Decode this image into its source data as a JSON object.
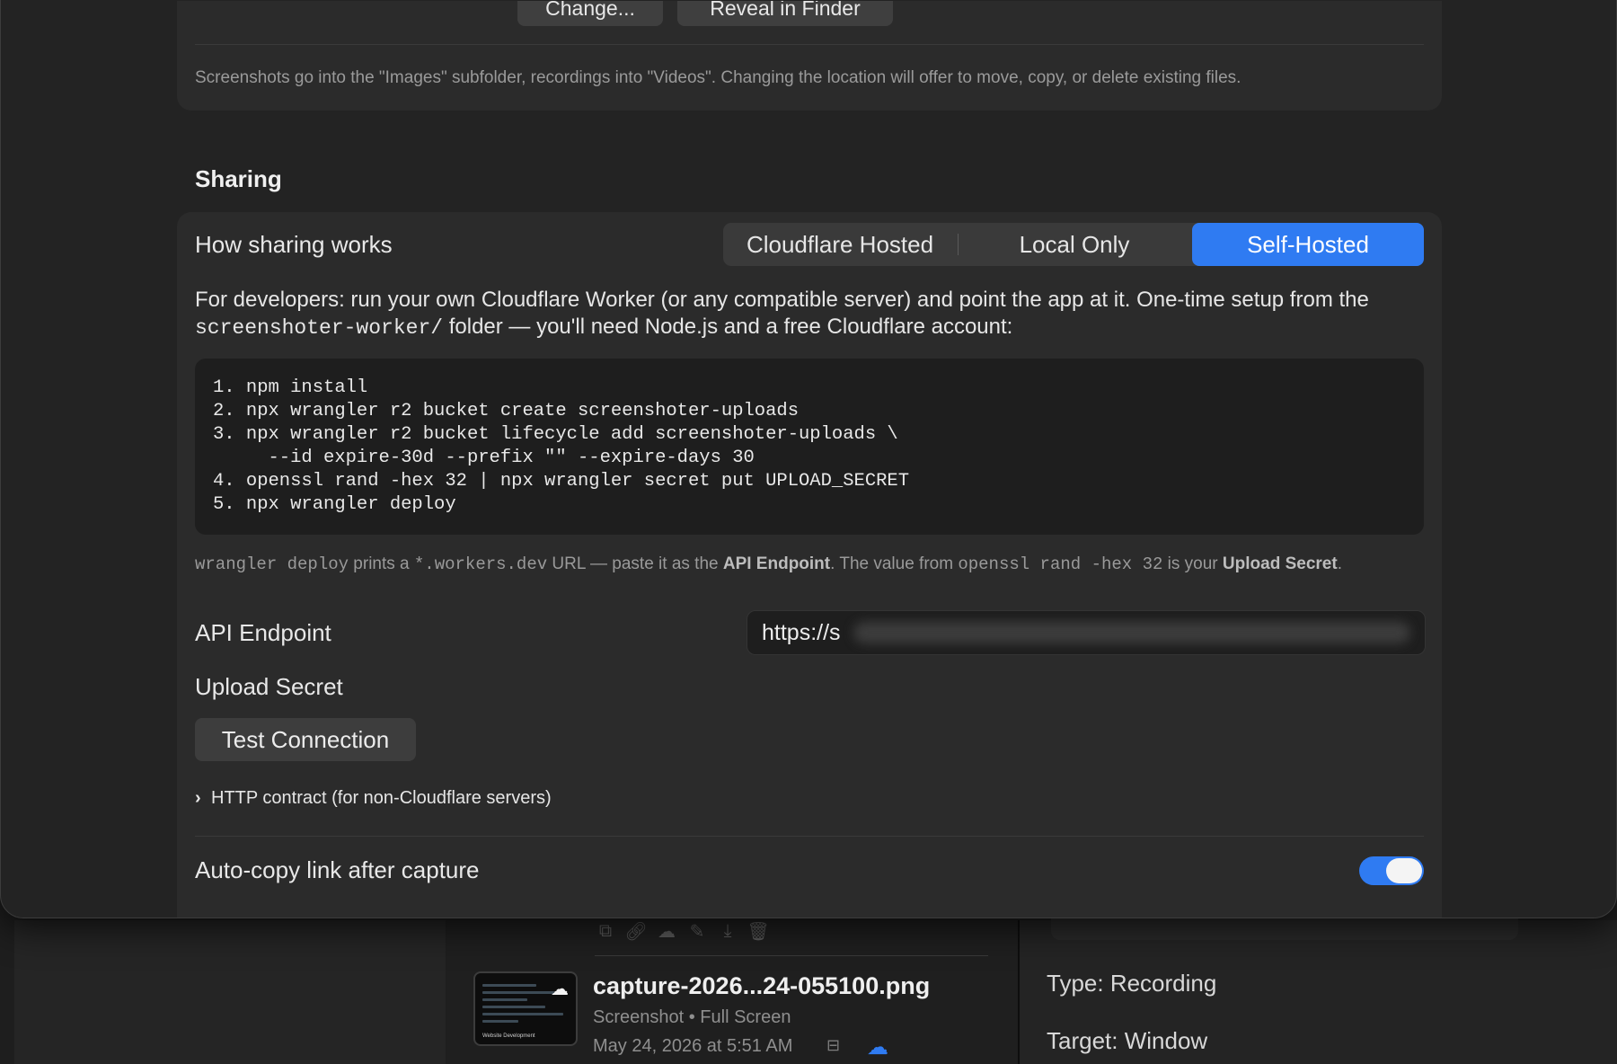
{
  "location": {
    "change_label": "Change...",
    "reveal_label": "Reveal in Finder",
    "hint": "Screenshots go into the \"Images\" subfolder, recordings into \"Videos\". Changing the location will offer to move, copy, or delete existing files."
  },
  "sharing": {
    "section_title": "Sharing",
    "how_label": "How sharing works",
    "modes": [
      "Cloudflare Hosted",
      "Local Only",
      "Self-Hosted"
    ],
    "selected_mode": "Self-Hosted",
    "desc_part1": "For developers: run your own Cloudflare Worker (or any compatible server) and point the app at it. One-time setup from the ",
    "desc_code": "screenshoter-worker/",
    "desc_part2": " folder — you'll need Node.js and a free Cloudflare account:",
    "setup_steps": "1. npm install\n2. npx wrangler r2 bucket create screenshoter-uploads\n3. npx wrangler r2 bucket lifecycle add screenshoter-uploads \\\n     --id expire-30d --prefix \"\" --expire-days 30\n4. openssl rand -hex 32 | npx wrangler secret put UPLOAD_SECRET\n5. npx wrangler deploy",
    "note_code1": "wrangler deploy",
    "note_t1": " prints a ",
    "note_code2": "*.workers.dev",
    "note_t2": " URL — paste it as the ",
    "note_b1": "API Endpoint",
    "note_t3": ". The value from ",
    "note_code3": "openssl rand -hex 32",
    "note_t4": " is your ",
    "note_b2": "Upload Secret",
    "note_t5": ".",
    "api_endpoint_label": "API Endpoint",
    "api_endpoint_value": "https://s",
    "upload_secret_label": "Upload Secret",
    "test_button": "Test Connection",
    "http_contract": "HTTP contract (for non-Cloudflare servers)",
    "autocopy_label": "Auto-copy link after capture",
    "autocopy_on": true
  },
  "background": {
    "file_name": "capture-2026...24-055100.png",
    "file_kind": "Screenshot • Full Screen",
    "file_date": "May 24, 2026 at 5:51 AM",
    "thumb_caption": "Website Development",
    "meta_type": "Type: Recording",
    "meta_target": "Target: Window"
  },
  "icons": {
    "toolbar": [
      "copy-icon",
      "link-icon",
      "cloud-link-icon",
      "pencil-icon",
      "download-icon",
      "trash-icon"
    ],
    "accent": "#2f7bf2"
  }
}
